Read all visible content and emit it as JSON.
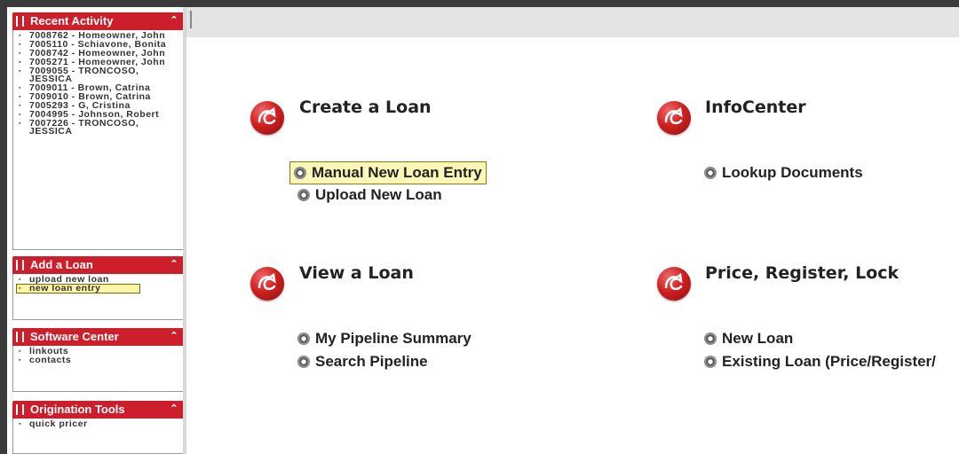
{
  "sidebar": {
    "recent_activity": {
      "title": "Recent Activity",
      "items": [
        {
          "label": "7008762 - Homeowner, John"
        },
        {
          "label": "7005110 - Schiavone, Bonita"
        },
        {
          "label": "7008742 - Homeowner, John"
        },
        {
          "label": "7005271 - Homeowner, John"
        },
        {
          "label": "7009055 - TRONCOSO, JESSICA"
        },
        {
          "label": "7009011 - Brown, Catrina"
        },
        {
          "label": "7009010 - Brown, Catrina"
        },
        {
          "label": "7005293 - G, Cristina"
        },
        {
          "label": "7004995 - Johnson, Robert"
        },
        {
          "label": "7007226 - TRONCOSO, JESSICA"
        }
      ]
    },
    "add_a_loan": {
      "title": "Add a Loan",
      "items": [
        {
          "label": "upload new loan"
        },
        {
          "label": "new loan entry"
        }
      ]
    },
    "software_center": {
      "title": "Software Center",
      "items": [
        {
          "label": "linkouts"
        },
        {
          "label": "contacts"
        }
      ]
    },
    "origination_tools": {
      "title": "Origination Tools",
      "items": [
        {
          "label": "quick pricer"
        }
      ]
    },
    "collapse_glyph": "⌃"
  },
  "main": {
    "create_loan": {
      "title": "Create a Loan",
      "links": [
        "Manual New Loan Entry",
        "Upload New Loan"
      ]
    },
    "infocenter": {
      "title": "InfoCenter",
      "links": [
        "Lookup Documents"
      ]
    },
    "view_loan": {
      "title": "View a Loan",
      "links": [
        "My Pipeline Summary",
        "Search Pipeline"
      ]
    },
    "price_register_lock": {
      "title": "Price, Register, Lock",
      "links": [
        "New Loan",
        "Existing Loan (Price/Register/"
      ]
    }
  },
  "colors": {
    "accent_red": "#cc1f2b",
    "highlight_yellow": "#fbf7b8"
  }
}
